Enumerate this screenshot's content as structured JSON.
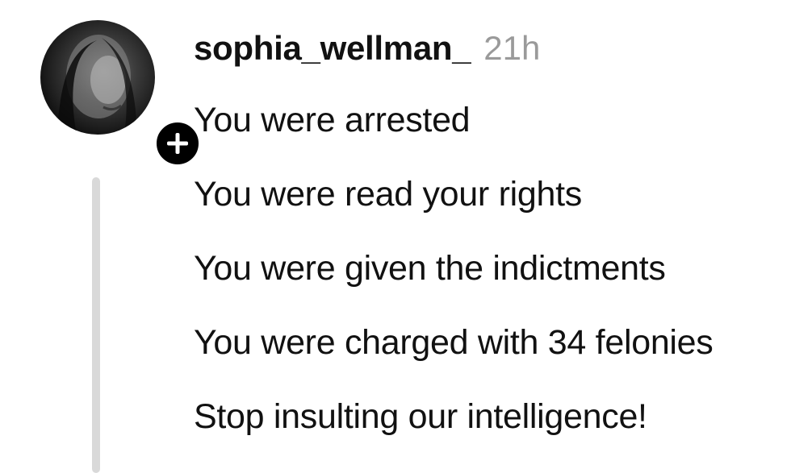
{
  "post": {
    "username": "sophia_wellman_",
    "time": "21h",
    "lines": [
      "You were arrested",
      "You were read your rights",
      "You were given the indictments",
      "You were charged with 34 felonies",
      "Stop insulting our intelligence!"
    ]
  },
  "icons": {
    "follow": "plus-icon",
    "avatar": "profile-photo"
  },
  "colors": {
    "text": "#111111",
    "timestamp": "#9a9a9a",
    "thread_line": "#d9d9d9",
    "badge": "#000000"
  }
}
